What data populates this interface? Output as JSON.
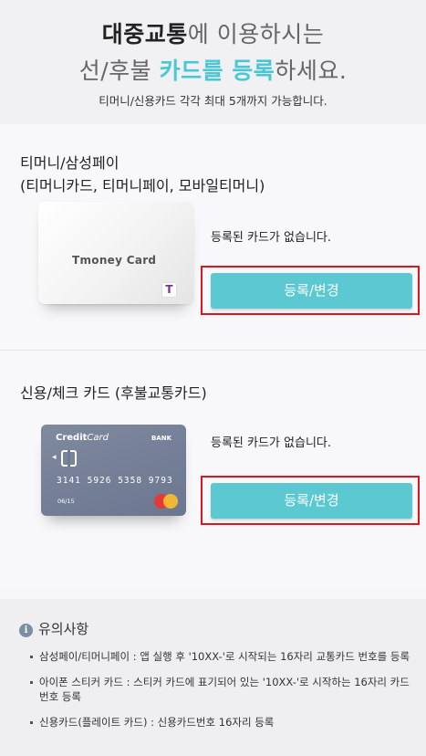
{
  "header": {
    "line1_bold": "대중교통",
    "line1_rest": "에 이용하시는",
    "line2_pre": "선/후불 ",
    "line2_highlight": "카드를 등록",
    "line2_post": "하세요.",
    "subtitle": "티머니/신용카드 각각 최대 5개까지 가능합니다."
  },
  "tmoney_section": {
    "title_line1": "티머니/삼성페이",
    "title_line2": "(티머니카드, 티머니페이, 모바일티머니)",
    "card_name": "Tmoney Card",
    "card_logo": "T",
    "status": "등록된 카드가 없습니다.",
    "button_label": "등록/변경"
  },
  "credit_section": {
    "title": "신용/체크 카드 (후불교통카드)",
    "card_brand_bold": "Credit",
    "card_brand_italic": "Card",
    "card_bank": "BANK",
    "card_number": "3141 5926 5358 9793",
    "card_expiry": "06/15",
    "status": "등록된 카드가 없습니다.",
    "button_label": "등록/변경"
  },
  "notice": {
    "icon": "info-icon",
    "title": "유의사항",
    "items": [
      "삼성페이/티머니페이 : 앱 실행 후 '10XX-'로 시작되는 16자리 교통카드 번호를 등록",
      "아이폰 스티커 카드 : 스티커 카드에 표기되어 있는 '10XX-'로 시작하는 16자리 카드 번호 등록",
      "신용카드(플레이트 카드) : 신용카드번호 16자리 등록"
    ]
  },
  "colors": {
    "accent": "#49c7d4",
    "button": "#5bc8d2",
    "highlight_border": "#e0141b"
  }
}
